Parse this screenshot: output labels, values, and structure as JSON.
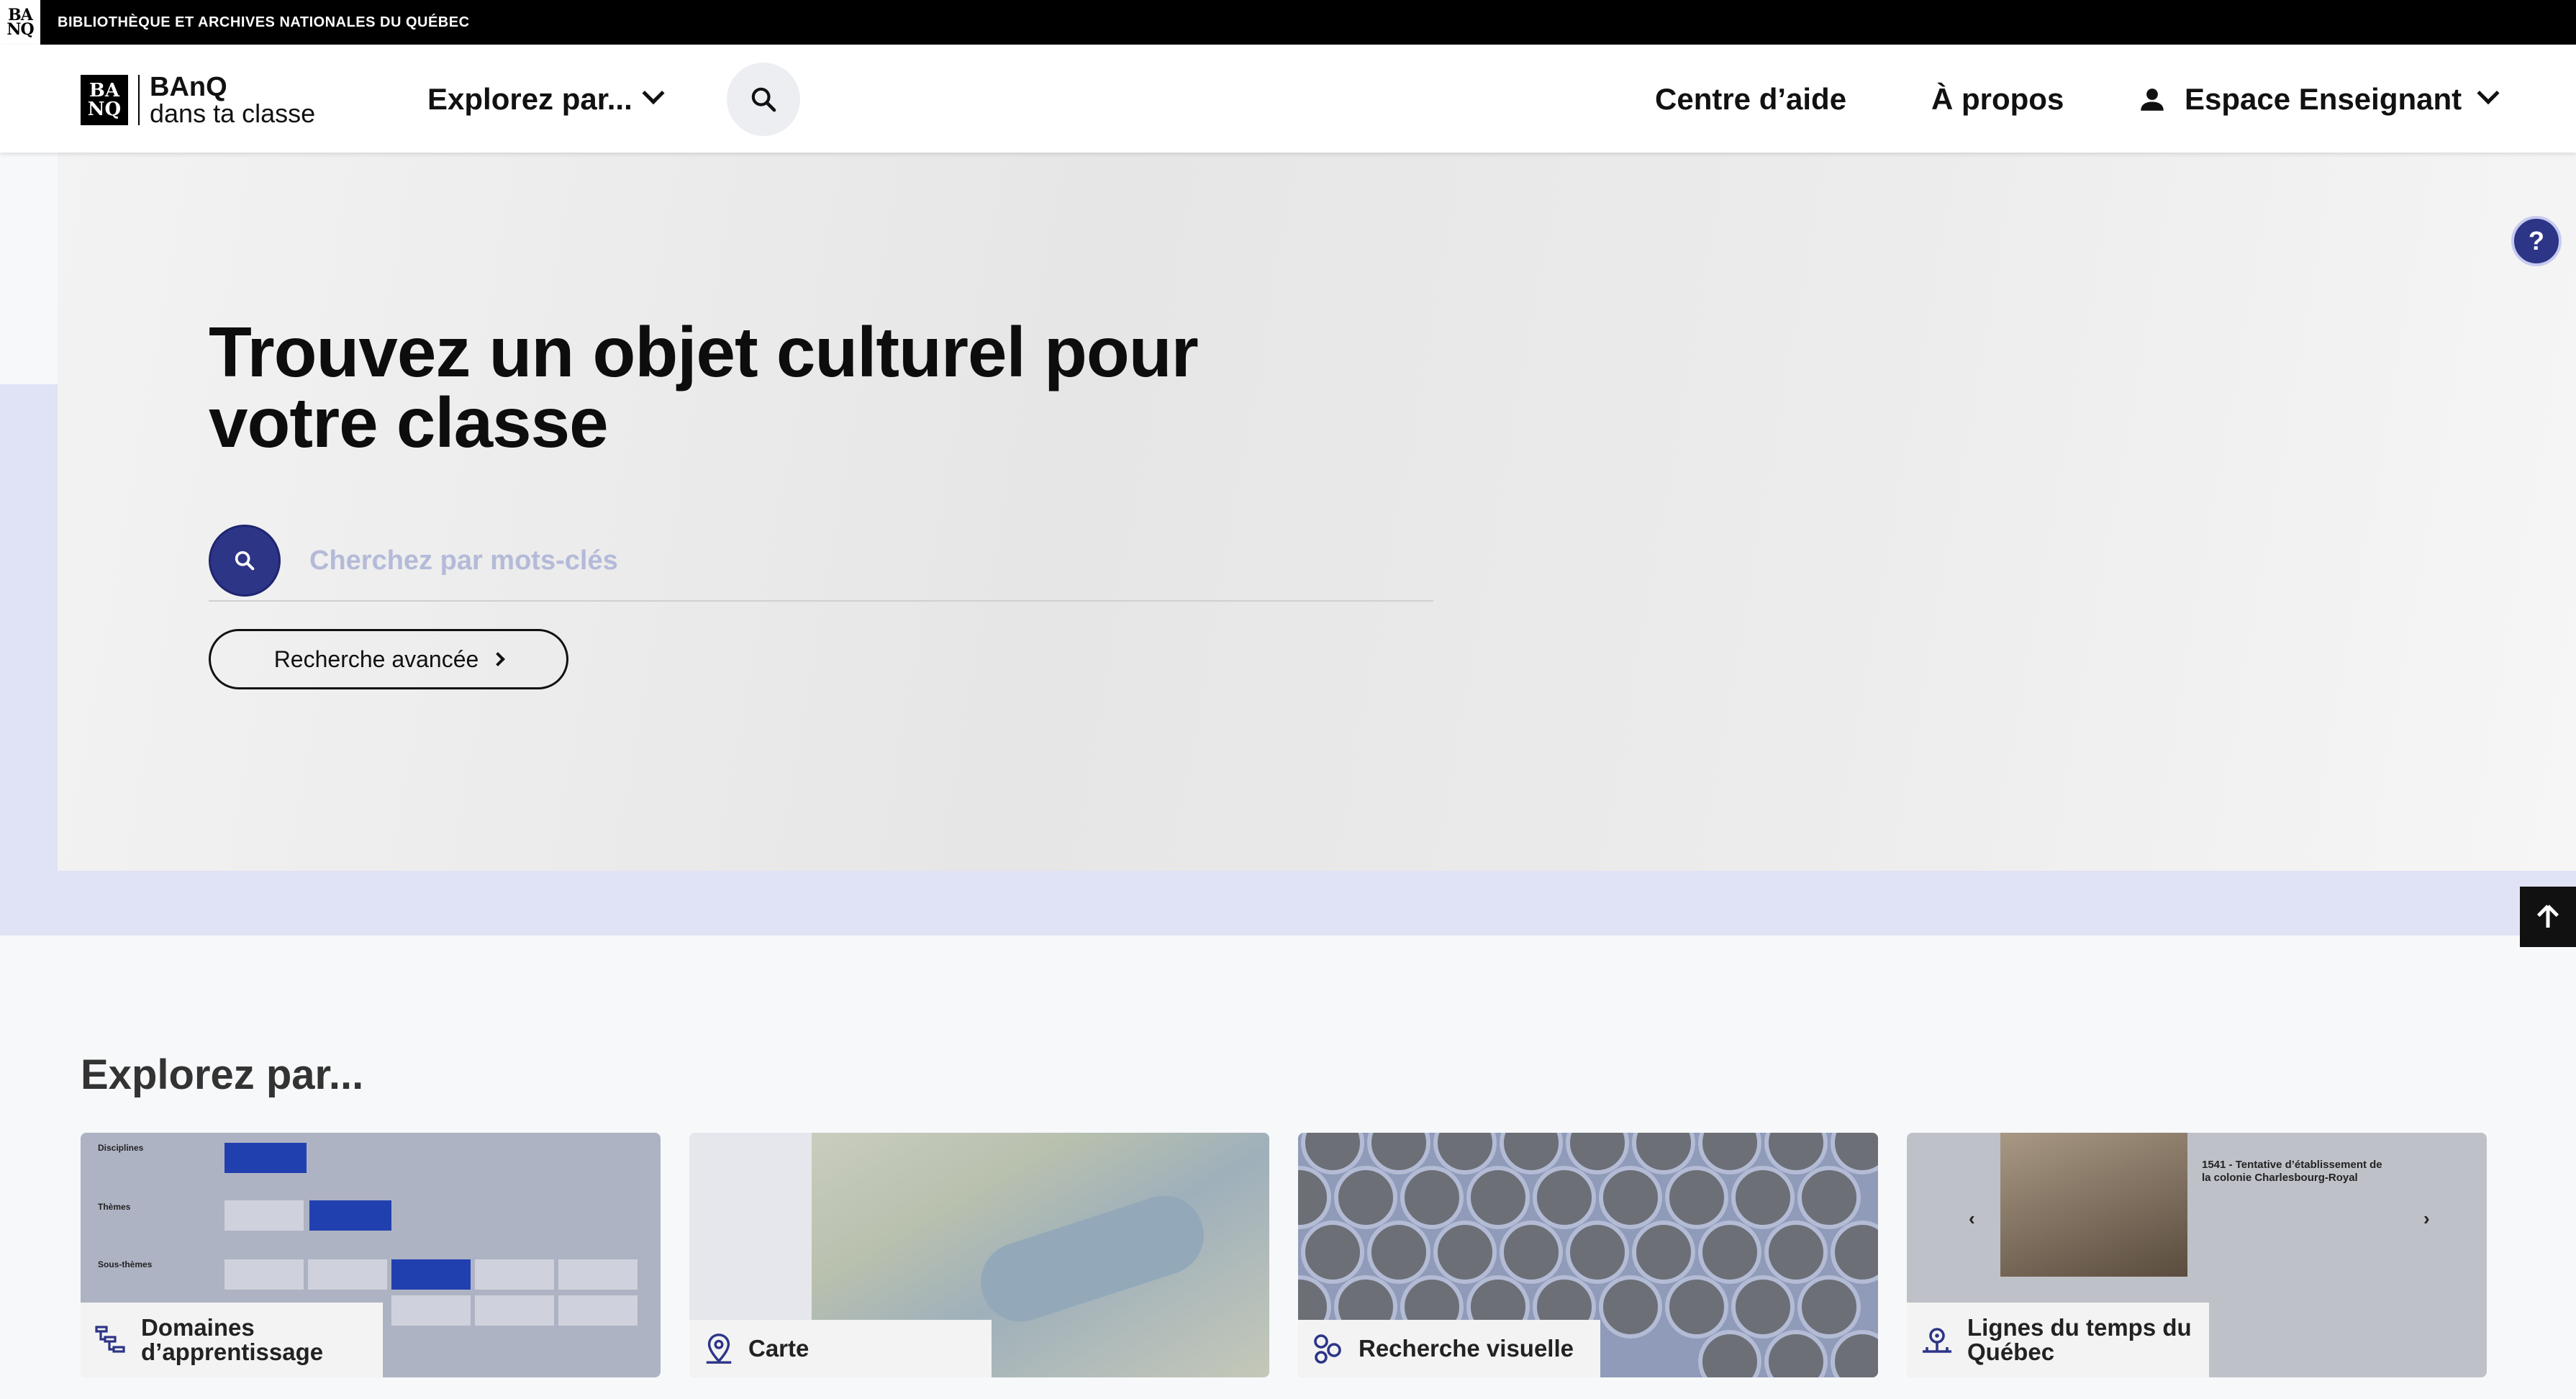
{
  "topbar": {
    "org_name": "BIBLIOTHÈQUE ET ARCHIVES NATIONALES DU QUÉBEC",
    "logo_text": "BA\nNQ"
  },
  "header": {
    "brand_line1": "BAnQ",
    "brand_line2": "dans ta classe",
    "explore_label": "Explorez par...",
    "nav": {
      "help": "Centre d’aide",
      "about": "À propos",
      "teacher": "Espace Enseignant"
    }
  },
  "hero": {
    "title": "Trouvez un objet culturel pour votre classe",
    "search_placeholder": "Cherchez par mots-clés",
    "advanced_label": "Recherche avancée"
  },
  "help_fab": "?",
  "explore": {
    "title": "Explorez par...",
    "cards": [
      {
        "label": "Domaines d’apprentissage",
        "icon": "hierarchy-icon"
      },
      {
        "label": "Carte",
        "icon": "map-pin-icon"
      },
      {
        "label": "Recherche visuelle",
        "icon": "hexagons-icon"
      },
      {
        "label": "Lignes du temps du Québec",
        "icon": "timeline-icon"
      }
    ],
    "card1_preview": {
      "rows": [
        "Disciplines",
        "Thèmes",
        "Sous-thèmes"
      ]
    },
    "card4_preview": {
      "title": "1541 - Tentative d’établissement de la colonie Charlesbourg-Royal"
    }
  },
  "colors": {
    "accent": "#2d3587",
    "hero_stripe": "#e0e2f5",
    "topbar": "#000000"
  }
}
